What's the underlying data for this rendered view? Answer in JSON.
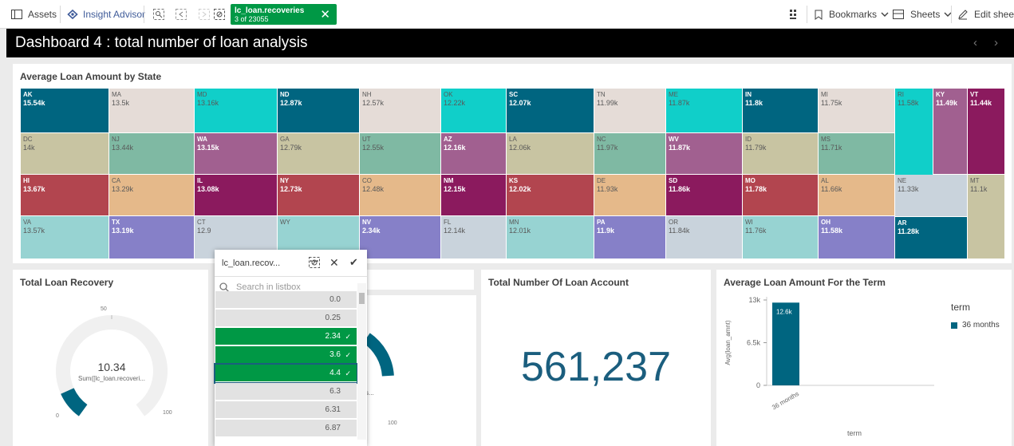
{
  "toolbar": {
    "assets": "Assets",
    "insight": "Insight Advisor",
    "selection_field": "lc_loan.recoveries",
    "selection_count": "3 of 23055",
    "bookmarks": "Bookmarks",
    "sheets": "Sheets",
    "edit": "Edit sheet",
    "close_glyph": "✕",
    "chevron_glyph": "⌄"
  },
  "sheet": {
    "title": "Dashboard 4 : total number of loan analysis",
    "prev_glyph": "‹",
    "next_glyph": "›"
  },
  "treemap": {
    "title": "Average Loan Amount by State",
    "tiles": [
      {
        "s": "AK",
        "v": "15.54k",
        "c": "#006580",
        "d": true
      },
      {
        "s": "MA",
        "v": "13.5k",
        "c": "#e5dcd7",
        "d": false
      },
      {
        "s": "MD",
        "v": "13.16k",
        "c": "#10cfc9",
        "d": false
      },
      {
        "s": "ND",
        "v": "12.87k",
        "c": "#006580",
        "d": true
      },
      {
        "s": "NH",
        "v": "12.57k",
        "c": "#e5dcd7",
        "d": false
      },
      {
        "s": "OK",
        "v": "12.22k",
        "c": "#10cfc9",
        "d": false
      },
      {
        "s": "SC",
        "v": "12.07k",
        "c": "#006580",
        "d": true
      },
      {
        "s": "TN",
        "v": "11.99k",
        "c": "#e5dcd7",
        "d": false
      },
      {
        "s": "ME",
        "v": "11.87k",
        "c": "#10cfc9",
        "d": false
      },
      {
        "s": "IN",
        "v": "11.8k",
        "c": "#006580",
        "d": true
      },
      {
        "s": "MI",
        "v": "11.75k",
        "c": "#e5dcd7",
        "d": false
      },
      {
        "s": "RI",
        "v": "11.58k",
        "c": "#10cfc9",
        "d": false
      },
      {
        "s": "KY",
        "v": "11.49k",
        "c": "#a16090",
        "d": true
      },
      {
        "s": "VT",
        "v": "11.44k",
        "c": "#8b1a5e",
        "d": true
      },
      {
        "s": "DC",
        "v": "14k",
        "c": "#c8c4a2",
        "d": false
      },
      {
        "s": "NJ",
        "v": "13.44k",
        "c": "#7fb9a3",
        "d": false
      },
      {
        "s": "WA",
        "v": "13.15k",
        "c": "#a16090",
        "d": true
      },
      {
        "s": "GA",
        "v": "12.79k",
        "c": "#c8c4a2",
        "d": false
      },
      {
        "s": "UT",
        "v": "12.55k",
        "c": "#7fb9a3",
        "d": false
      },
      {
        "s": "AZ",
        "v": "12.16k",
        "c": "#a16090",
        "d": true
      },
      {
        "s": "LA",
        "v": "12.06k",
        "c": "#c8c4a2",
        "d": false
      },
      {
        "s": "NC",
        "v": "11.97k",
        "c": "#7fb9a3",
        "d": false
      },
      {
        "s": "WV",
        "v": "11.87k",
        "c": "#a16090",
        "d": true
      },
      {
        "s": "ID",
        "v": "11.79k",
        "c": "#c8c4a2",
        "d": false
      },
      {
        "s": "MS",
        "v": "11.71k",
        "c": "#7fb9a3",
        "d": false
      },
      {
        "s": "HI",
        "v": "13.67k",
        "c": "#b2454f",
        "d": true
      },
      {
        "s": "CA",
        "v": "13.29k",
        "c": "#e5b98a",
        "d": false
      },
      {
        "s": "IL",
        "v": "13.08k",
        "c": "#8b1a5e",
        "d": true
      },
      {
        "s": "NY",
        "v": "12.73k",
        "c": "#b2454f",
        "d": true
      },
      {
        "s": "CO",
        "v": "12.48k",
        "c": "#e5b98a",
        "d": false
      },
      {
        "s": "NM",
        "v": "12.15k",
        "c": "#8b1a5e",
        "d": true
      },
      {
        "s": "KS",
        "v": "12.02k",
        "c": "#b2454f",
        "d": true
      },
      {
        "s": "DE",
        "v": "11.93k",
        "c": "#e5b98a",
        "d": false
      },
      {
        "s": "SD",
        "v": "11.86k",
        "c": "#8b1a5e",
        "d": true
      },
      {
        "s": "MO",
        "v": "11.78k",
        "c": "#b2454f",
        "d": true
      },
      {
        "s": "AL",
        "v": "11.66k",
        "c": "#e5b98a",
        "d": false
      },
      {
        "s": "NE",
        "v": "11.33k",
        "c": "#c9d3dc",
        "d": false
      },
      {
        "s": "MT",
        "v": "11.1k",
        "c": "#c8c4a2",
        "d": false
      },
      {
        "s": "VA",
        "v": "13.57k",
        "c": "#97d3d2",
        "d": false
      },
      {
        "s": "TX",
        "v": "13.19k",
        "c": "#8680c8",
        "d": true
      },
      {
        "s": "CT",
        "v": "12.9",
        "c": "#c9d3dc",
        "d": false
      },
      {
        "s": "WY",
        "v": "",
        "c": "#97d3d2",
        "d": false
      },
      {
        "s": "NV",
        "v": "2.34k",
        "c": "#8680c8",
        "d": true
      },
      {
        "s": "FL",
        "v": "12.14k",
        "c": "#c9d3dc",
        "d": false
      },
      {
        "s": "MN",
        "v": "12.01k",
        "c": "#97d3d2",
        "d": false
      },
      {
        "s": "PA",
        "v": "11.9k",
        "c": "#8680c8",
        "d": true
      },
      {
        "s": "OR",
        "v": "11.84k",
        "c": "#c9d3dc",
        "d": false
      },
      {
        "s": "WI",
        "v": "11.76k",
        "c": "#97d3d2",
        "d": false
      },
      {
        "s": "OH",
        "v": "11.58k",
        "c": "#8680c8",
        "d": true
      },
      {
        "s": "AR",
        "v": "11.28k",
        "c": "#006580",
        "d": true
      }
    ]
  },
  "recovery": {
    "title": "Total Loan Recovery",
    "value": "10.34",
    "sub": "Sum([lc_loan.recoveri...",
    "min": "0",
    "mid": "50",
    "max": "100",
    "gauge_fraction": 0.1034
  },
  "gauge2": {
    "sub_fragment": "s...",
    "max": "100",
    "gauge_fraction": 0.8
  },
  "kpi": {
    "title": "Total Number Of Loan Account",
    "value": "561,237"
  },
  "term_chart": {
    "title": "Average Loan Amount For the Term",
    "legend_title": "term",
    "legend_item": "36 months",
    "color": "#006580",
    "chart_data": {
      "type": "bar",
      "categories": [
        "36 months"
      ],
      "values": [
        12600
      ],
      "data_labels": [
        "12.6k"
      ],
      "xlabel": "term",
      "ylabel": "Avg(loan_amnt)",
      "yticks": [
        "0",
        "6.5k",
        "13k"
      ],
      "ylim": [
        0,
        13000
      ]
    }
  },
  "listbox": {
    "field": "lc_loan.recov...",
    "more_glyph": "···",
    "close_glyph": "✕",
    "confirm_glyph": "✔",
    "check_glyph": "✓",
    "search_placeholder": "Search in listbox",
    "items": [
      {
        "label": "0.0",
        "state": "alt"
      },
      {
        "label": "0.25",
        "state": "alt"
      },
      {
        "label": "2.34",
        "state": "sel"
      },
      {
        "label": "3.6",
        "state": "sel"
      },
      {
        "label": "4.4",
        "state": "sel"
      },
      {
        "label": "6.3",
        "state": "alt"
      },
      {
        "label": "6.31",
        "state": "alt"
      },
      {
        "label": "6.87",
        "state": "alt"
      }
    ]
  }
}
